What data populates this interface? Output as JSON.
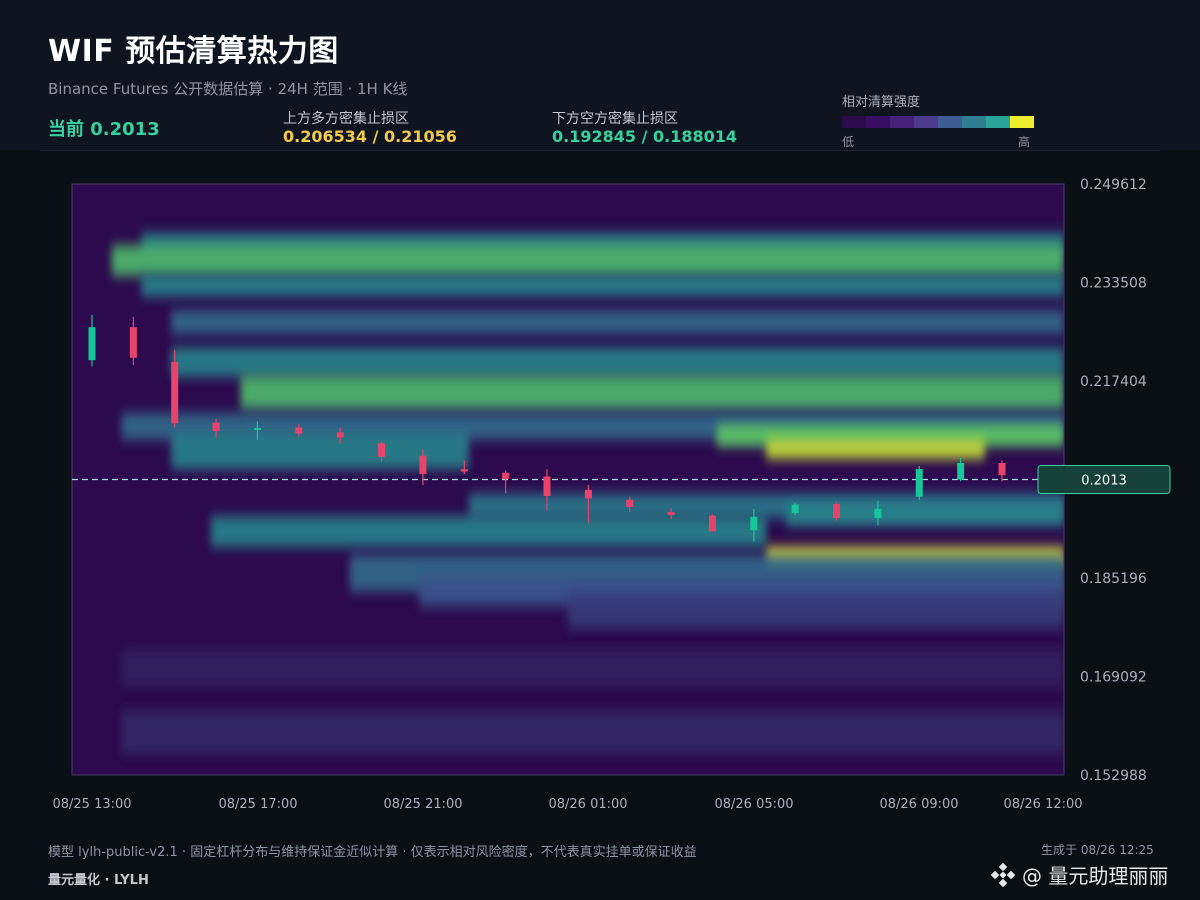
{
  "header": {
    "title": "WIF 预估清算热力图",
    "subtitle": "Binance Futures 公开数据估算 · 24H 范围 · 1H K线",
    "current_label": "当前 0.2013",
    "upper_label": "上方多方密集止损区",
    "upper_value": "0.206534 / 0.21056",
    "lower_label": "下方空方密集止损区",
    "lower_value": "0.192845 / 0.188014",
    "legend_title": "相对清算强度",
    "legend_low": "低",
    "legend_high": "高"
  },
  "colors": {
    "background": "#0a0e15",
    "accent_green": "#3ad1a1",
    "accent_yellow": "#f2c94c",
    "candle_up": "#16c79a",
    "candle_down": "#e8436b",
    "legend_scale": [
      "#2b0a4b",
      "#3a0e63",
      "#46227a",
      "#4a3c8a",
      "#3c5c93",
      "#2e7d91",
      "#2aa39a",
      "#f0ec2e"
    ]
  },
  "chart_data": {
    "type": "heatmap",
    "title": "WIF 预估清算热力图",
    "x_ticks": [
      "08/25 13:00",
      "08/25 17:00",
      "08/25 21:00",
      "08/26 01:00",
      "08/26 05:00",
      "08/26 09:00",
      "08/26 12:00"
    ],
    "y_ticks": [
      "0.249612",
      "0.233508",
      "0.217404",
      "0.201300",
      "0.185196",
      "0.169092",
      "0.152988"
    ],
    "y_tick_visible": [
      true,
      true,
      true,
      false,
      true,
      true,
      true
    ],
    "ylim": [
      0.152988,
      0.249612
    ],
    "current_price": 0.2013,
    "current_price_label": "0.2013",
    "candles": [
      {
        "o": 0.2208,
        "h": 0.2282,
        "l": 0.2198,
        "c": 0.2262
      },
      {
        "o": 0.2262,
        "h": 0.2279,
        "l": 0.22,
        "c": 0.2212
      },
      {
        "o": 0.2205,
        "h": 0.2225,
        "l": 0.2098,
        "c": 0.2105
      },
      {
        "o": 0.2106,
        "h": 0.2112,
        "l": 0.2082,
        "c": 0.2092
      },
      {
        "o": 0.2096,
        "h": 0.2108,
        "l": 0.2078,
        "c": 0.2097
      },
      {
        "o": 0.2098,
        "h": 0.2104,
        "l": 0.2083,
        "c": 0.2088
      },
      {
        "o": 0.209,
        "h": 0.2098,
        "l": 0.2072,
        "c": 0.2082
      },
      {
        "o": 0.2072,
        "h": 0.2075,
        "l": 0.2042,
        "c": 0.205
      },
      {
        "o": 0.2052,
        "h": 0.2062,
        "l": 0.2004,
        "c": 0.2022
      },
      {
        "o": 0.203,
        "h": 0.2044,
        "l": 0.2022,
        "c": 0.2026
      },
      {
        "o": 0.2024,
        "h": 0.2028,
        "l": 0.199,
        "c": 0.2014
      },
      {
        "o": 0.2018,
        "h": 0.203,
        "l": 0.1962,
        "c": 0.1986
      },
      {
        "o": 0.1996,
        "h": 0.2004,
        "l": 0.1942,
        "c": 0.1982
      },
      {
        "o": 0.198,
        "h": 0.1985,
        "l": 0.196,
        "c": 0.1968
      },
      {
        "o": 0.196,
        "h": 0.1966,
        "l": 0.1948,
        "c": 0.1955
      },
      {
        "o": 0.1954,
        "h": 0.1956,
        "l": 0.1932,
        "c": 0.1928
      },
      {
        "o": 0.193,
        "h": 0.1965,
        "l": 0.1912,
        "c": 0.1952
      },
      {
        "o": 0.1958,
        "h": 0.1975,
        "l": 0.1955,
        "c": 0.1972
      },
      {
        "o": 0.1973,
        "h": 0.1976,
        "l": 0.1946,
        "c": 0.195
      },
      {
        "o": 0.195,
        "h": 0.1978,
        "l": 0.1938,
        "c": 0.1965
      },
      {
        "o": 0.1985,
        "h": 0.2035,
        "l": 0.198,
        "c": 0.203
      },
      {
        "o": 0.2013,
        "h": 0.2048,
        "l": 0.201,
        "c": 0.204
      },
      {
        "o": 0.204,
        "h": 0.2044,
        "l": 0.201,
        "c": 0.202
      }
    ],
    "heat_bands": [
      {
        "y": 0.2398,
        "w": 0.0018,
        "t0": 0.07,
        "t1": 1.0,
        "a": 0.55
      },
      {
        "y": 0.2371,
        "w": 0.0025,
        "t0": 0.04,
        "t1": 1.0,
        "a": 0.75
      },
      {
        "y": 0.233,
        "w": 0.0018,
        "t0": 0.07,
        "t1": 1.0,
        "a": 0.55
      },
      {
        "y": 0.227,
        "w": 0.002,
        "t0": 0.1,
        "t1": 1.0,
        "a": 0.45
      },
      {
        "y": 0.2205,
        "w": 0.0024,
        "t0": 0.1,
        "t1": 1.0,
        "a": 0.55
      },
      {
        "y": 0.2155,
        "w": 0.0028,
        "t0": 0.17,
        "t1": 1.0,
        "a": 0.75
      },
      {
        "y": 0.21,
        "w": 0.0022,
        "t0": 0.05,
        "t1": 1.0,
        "a": 0.45
      },
      {
        "y": 0.2085,
        "w": 0.0018,
        "t0": 0.65,
        "t1": 1.0,
        "a": 0.8
      },
      {
        "y": 0.2063,
        "w": 0.0016,
        "t0": 0.7,
        "t1": 0.92,
        "a": 0.95
      },
      {
        "y": 0.206,
        "w": 0.003,
        "t0": 0.1,
        "t1": 0.4,
        "a": 0.55
      },
      {
        "y": 0.197,
        "w": 0.002,
        "t0": 0.4,
        "t1": 1.0,
        "a": 0.5
      },
      {
        "y": 0.1955,
        "w": 0.0018,
        "t0": 0.72,
        "t1": 1.0,
        "a": 0.55
      },
      {
        "y": 0.1928,
        "w": 0.0025,
        "t0": 0.14,
        "t1": 0.7,
        "a": 0.55
      },
      {
        "y": 0.1886,
        "w": 0.0016,
        "t0": 0.7,
        "t1": 1.0,
        "a": 1.0
      },
      {
        "y": 0.186,
        "w": 0.003,
        "t0": 0.28,
        "t1": 1.0,
        "a": 0.45
      },
      {
        "y": 0.183,
        "w": 0.0025,
        "t0": 0.35,
        "t1": 1.0,
        "a": 0.35
      },
      {
        "y": 0.18,
        "w": 0.003,
        "t0": 0.5,
        "t1": 1.0,
        "a": 0.25
      },
      {
        "y": 0.1705,
        "w": 0.003,
        "t0": 0.05,
        "t1": 1.0,
        "a": 0.12
      },
      {
        "y": 0.16,
        "w": 0.0035,
        "t0": 0.05,
        "t1": 1.0,
        "a": 0.15
      }
    ]
  },
  "footer": {
    "note": "模型 lylh-public-v2.1 · 固定杠杆分布与维持保证金近似计算 · 仅表示相对风险密度，不代表真实挂单或保证收益",
    "generated": "生成于 08/26 12:25",
    "brand": "量元量化 · LYLH",
    "watermark": "@ 量元助理丽丽"
  }
}
